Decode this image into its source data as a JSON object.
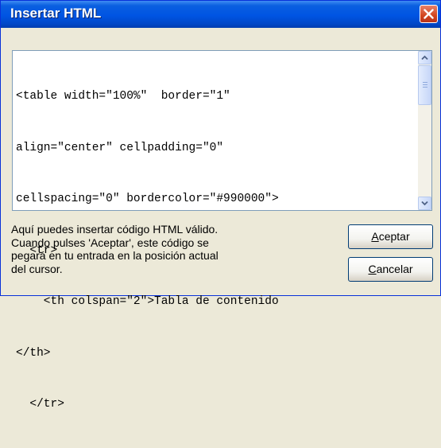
{
  "window": {
    "title": "Insertar HTML"
  },
  "code_editor": {
    "lines": [
      "<table width=\"100%\"  border=\"1\"",
      "align=\"center\" cellpadding=\"0\"",
      "cellspacing=\"0\" bordercolor=\"#990000\">",
      "  <tr>",
      "    <th colspan=\"2\">Tabla de contenido",
      "</th>",
      "  </tr>"
    ]
  },
  "help_text": {
    "lines": [
      "Aquí puedes insertar código HTML válido.",
      "Cuando pulses 'Aceptar', este código se",
      "pegará en tu entrada en la posición actual",
      "del cursor."
    ]
  },
  "buttons": {
    "accept": {
      "mnemonic": "A",
      "rest": "ceptar"
    },
    "cancel": {
      "mnemonic": "C",
      "rest": "ancelar"
    }
  },
  "icons": {
    "close": "close-icon",
    "scroll_up": "arrow-up-icon",
    "scroll_down": "arrow-down-icon"
  },
  "colors": {
    "title_bar": "#0054E3",
    "close_button": "#D2461E",
    "dialog_background": "#ECE9D8",
    "field_border": "#7F9DB9"
  }
}
